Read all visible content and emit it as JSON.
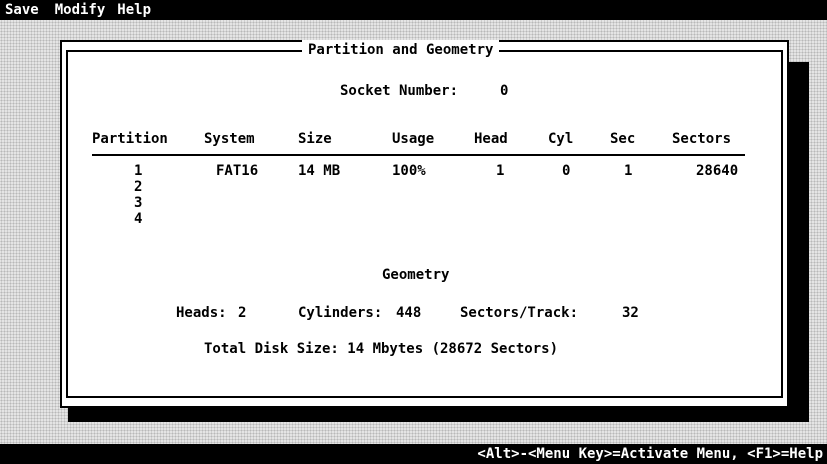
{
  "menu": {
    "save": "Save",
    "modify": "Modify",
    "help": "Help"
  },
  "dialog": {
    "title": "Partition and Geometry",
    "socket_label": "Socket Number:",
    "socket_value": "0"
  },
  "table": {
    "headers": [
      "Partition",
      "System",
      "Size",
      "Usage",
      "Head",
      "Cyl",
      "Sec",
      "Sectors"
    ],
    "rows": [
      {
        "partition": "1",
        "system": "FAT16",
        "size": "14 MB",
        "usage": "100%",
        "head": "1",
        "cyl": "0",
        "sec": "1",
        "sectors": "28640"
      },
      {
        "partition": "2"
      },
      {
        "partition": "3"
      },
      {
        "partition": "4"
      }
    ]
  },
  "geometry": {
    "title": "Geometry",
    "heads_label": "Heads:",
    "heads_value": "2",
    "cylinders_label": "Cylinders:",
    "cylinders_value": "448",
    "sectors_track_label": "Sectors/Track:",
    "sectors_track_value": "32",
    "total_size": "Total Disk Size: 14 Mbytes (28672 Sectors)"
  },
  "status": {
    "hint": "<Alt>-<Menu Key>=Activate Menu, <F1>=Help"
  }
}
